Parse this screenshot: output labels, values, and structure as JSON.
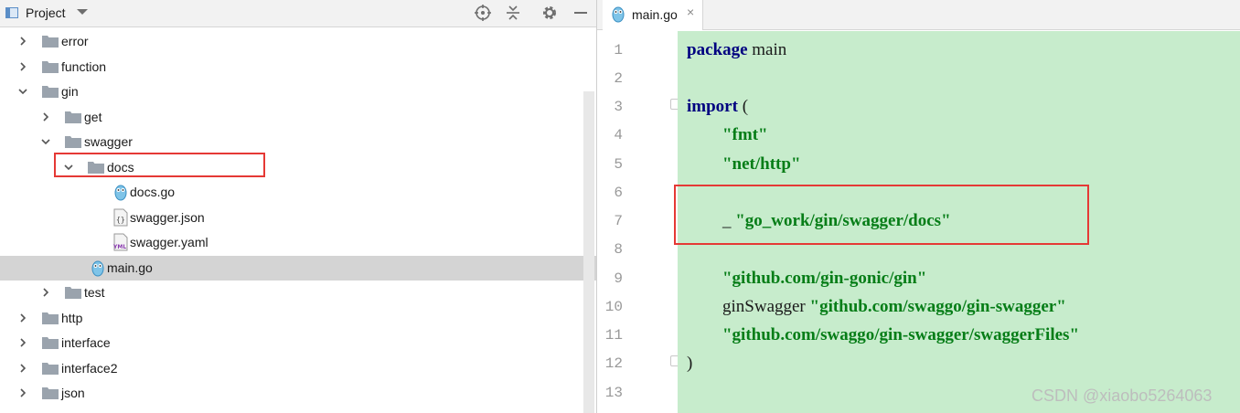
{
  "project_panel": {
    "title": "Project",
    "tree": [
      {
        "label": "error",
        "type": "folder",
        "expanded": false
      },
      {
        "label": "function",
        "type": "folder",
        "expanded": false
      },
      {
        "label": "gin",
        "type": "folder",
        "expanded": true
      },
      {
        "label": "get",
        "type": "folder",
        "expanded": false
      },
      {
        "label": "swagger",
        "type": "folder",
        "expanded": true
      },
      {
        "label": "docs",
        "type": "folder",
        "expanded": true
      },
      {
        "label": "docs.go",
        "type": "go-file"
      },
      {
        "label": "swagger.json",
        "type": "json-file"
      },
      {
        "label": "swagger.yaml",
        "type": "yaml-file"
      },
      {
        "label": "main.go",
        "type": "go-file",
        "selected": true
      },
      {
        "label": "test",
        "type": "folder",
        "expanded": false
      },
      {
        "label": "http",
        "type": "folder",
        "expanded": false
      },
      {
        "label": "interface",
        "type": "folder",
        "expanded": false
      },
      {
        "label": "interface2",
        "type": "folder",
        "expanded": false
      },
      {
        "label": "json",
        "type": "folder",
        "expanded": false
      }
    ]
  },
  "editor": {
    "tab_label": "main.go",
    "tab_close": "×",
    "line_numbers": [
      "1",
      "2",
      "3",
      "4",
      "5",
      "6",
      "7",
      "8",
      "9",
      "10",
      "11",
      "12",
      "13"
    ],
    "code": {
      "l1_kw": "package",
      "l1_id": " main",
      "l3_kw": "import",
      "l3_id": " (",
      "l4_str": "\"fmt\"",
      "l5_str": "\"net/http\"",
      "l7_id": "_ ",
      "l7_str": "\"go_work/gin/swagger/docs\"",
      "l9_str": "\"github.com/gin-gonic/gin\"",
      "l10_id": "ginSwagger ",
      "l10_str": "\"github.com/swaggo/gin-swagger\"",
      "l11_str": "\"github.com/swaggo/gin-swagger/swaggerFiles\"",
      "l12_id": ")"
    },
    "background": "#c7eccc"
  },
  "watermark": "CSDN @xiaobo5264063",
  "colors": {
    "highlight_box": "#e53935",
    "keyword": "#000080",
    "string": "#067d17"
  }
}
